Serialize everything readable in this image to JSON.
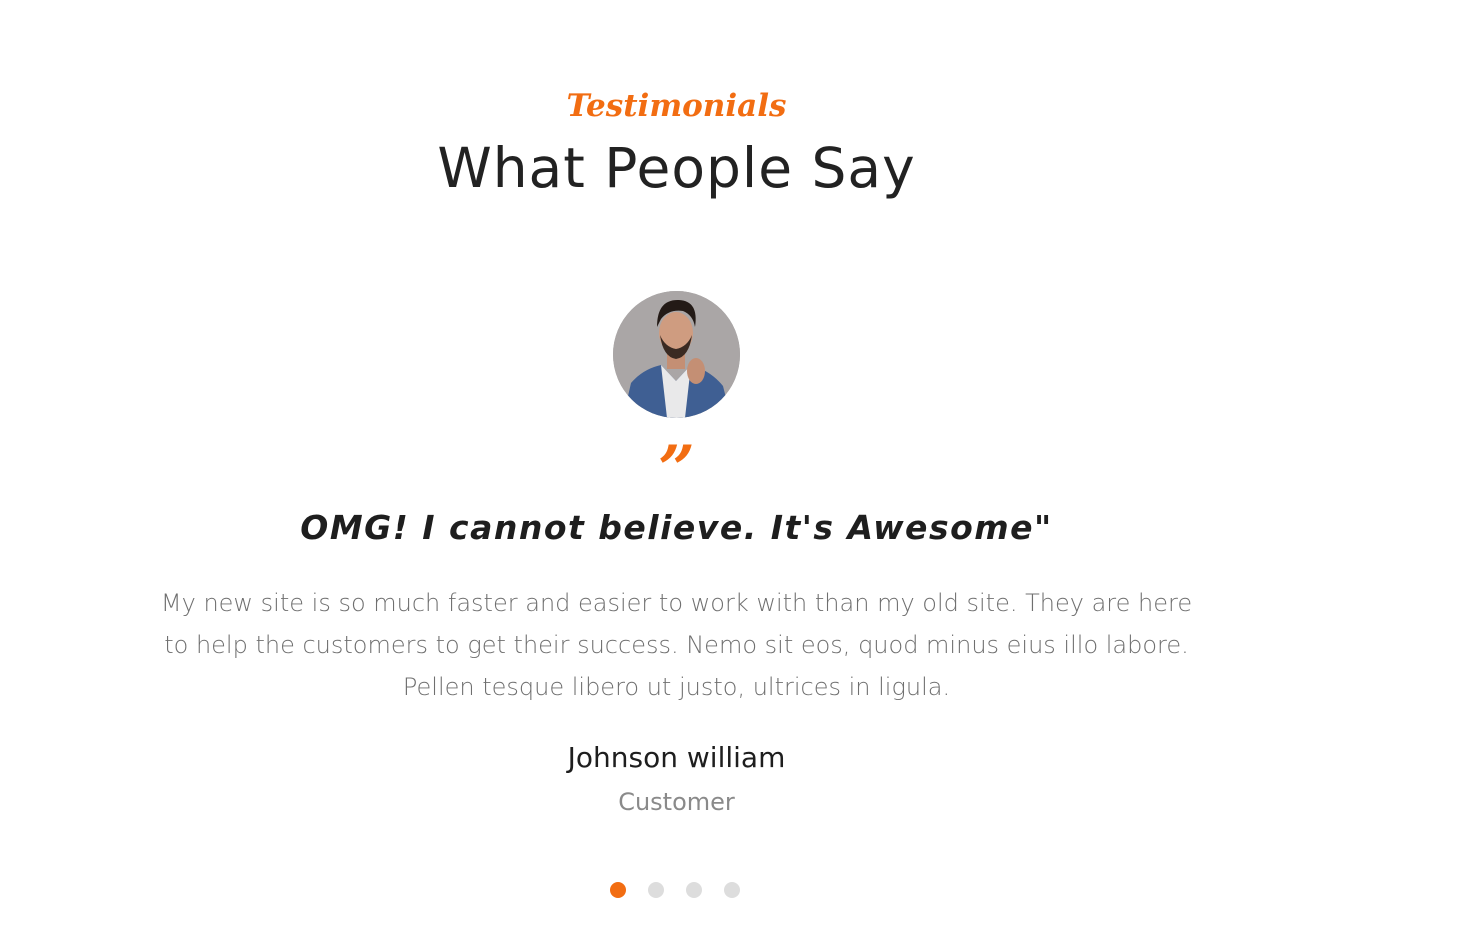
{
  "section": {
    "eyebrow": "Testimonials",
    "heading": "What People Say"
  },
  "testimonial": {
    "avatar_icon": "person-portrait",
    "quote_mark": "”",
    "title": "OMG! I cannot believe. It's Awesome\"",
    "body": "My new site is so much faster and easier to work with than my old site. They are here to help the customers to get their success. Nemo sit eos, quod minus eius illo labore. Pellen tesque libero ut justo, ultrices in ligula.",
    "author_name": "Johnson william",
    "author_role": "Customer"
  },
  "carousel": {
    "total": 4,
    "active_index": 0
  },
  "colors": {
    "accent": "#f26d12",
    "heading": "#222222",
    "body_text": "#6f6f6f",
    "dot_inactive": "#dddddd"
  }
}
